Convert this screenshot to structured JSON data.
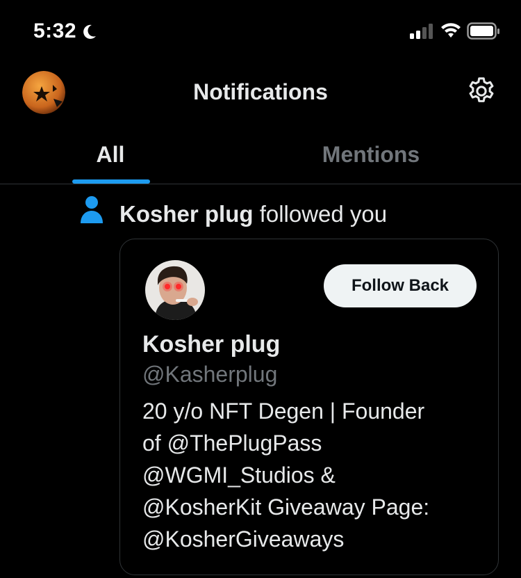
{
  "status_bar": {
    "time": "5:32",
    "icons": [
      "moon-icon",
      "signal-icon",
      "wifi-icon",
      "battery-icon"
    ]
  },
  "header": {
    "title": "Notifications",
    "avatar_icon": "profile-avatar",
    "settings_icon": "gear-icon"
  },
  "tabs": [
    {
      "label": "All",
      "active": true
    },
    {
      "label": "Mentions",
      "active": false
    }
  ],
  "colors": {
    "background": "#000000",
    "accent": "#1d9bf0",
    "secondary_text": "#71767b",
    "button_bg": "#eff3f4"
  },
  "notification": {
    "icon": "person-icon",
    "actor": "Kosher plug",
    "action": "followed you",
    "card": {
      "name": "Kosher plug",
      "handle": "@Kasherplug",
      "bio_lines": [
        "20 y/o NFT Degen | Founder",
        "of @ThePlugPass",
        "@WGMI_Studios &",
        "@KosherKit Giveaway Page:",
        "@KosherGiveaways"
      ],
      "follow_button": "Follow Back"
    }
  }
}
